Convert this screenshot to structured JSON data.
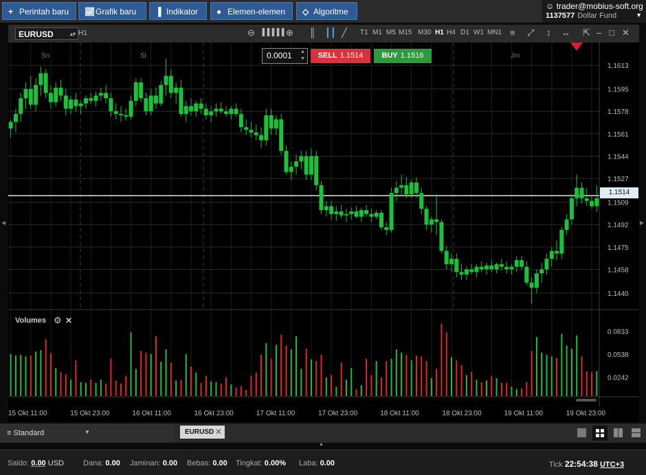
{
  "toolbar": {
    "new_order": "Perintah baru",
    "new_chart": "Grafik baru",
    "indicators": "Indikator",
    "elements": "Elemen-elemen",
    "algorithms": "Algoritme"
  },
  "account": {
    "user": "trader@mobius-soft.org",
    "number": "1137577",
    "fund": "Dollar Fund"
  },
  "chart_header": {
    "symbol": "EURUSD",
    "period": "H1",
    "timeframes": [
      "T1",
      "M1",
      "M5",
      "M15",
      "M30",
      "H1",
      "H4",
      "D1",
      "W1",
      "MN1"
    ],
    "active_timeframe": "H1"
  },
  "trade": {
    "step": "0.0001",
    "sell_label": "SELL",
    "sell_price": "1.1514",
    "buy_label": "BUY",
    "buy_price": "1.1516",
    "sell_color": "#d9323a",
    "buy_color": "#2e9a3c"
  },
  "current_price": "1.1514",
  "volumes_panel": {
    "title": "Volumes"
  },
  "chart_data": {
    "type": "candlestick",
    "symbol": "EURUSD",
    "period": "H1",
    "day_labels": [
      "Sn",
      "Sl",
      "Jm"
    ],
    "price_axis_ticks": [
      "1.1613",
      "1.1595",
      "1.1578",
      "1.1561",
      "1.1544",
      "1.1527",
      "1.1509",
      "1.1492",
      "1.1475",
      "1.1458",
      "1.1440"
    ],
    "ylim": [
      1.1428,
      1.1624
    ],
    "volume_axis_ticks": [
      "0.0833",
      "0.0538",
      "0.0242"
    ],
    "volume_ylim": [
      0,
      0.105
    ],
    "x_axis_labels": [
      "15 Okt 11:00",
      "15 Okt 23:00",
      "16 Okt 11:00",
      "16 Okt 23:00",
      "17 Okt 11:00",
      "17 Okt 23:00",
      "18 Okt 11:00",
      "18 Okt 23:00",
      "19 Okt 11:00",
      "19 Okt 23:00"
    ],
    "up_color": "#19c23a",
    "down_color": "#e8242b",
    "candles": [
      [
        1.1565,
        1.1572,
        1.1558,
        1.157
      ],
      [
        1.157,
        1.158,
        1.1562,
        1.1576
      ],
      [
        1.1576,
        1.1592,
        1.157,
        1.1588
      ],
      [
        1.1588,
        1.16,
        1.158,
        1.1595
      ],
      [
        1.1595,
        1.1605,
        1.158,
        1.1583
      ],
      [
        1.1583,
        1.1603,
        1.1578,
        1.1598
      ],
      [
        1.1598,
        1.1612,
        1.159,
        1.1607
      ],
      [
        1.1607,
        1.161,
        1.1588,
        1.1592
      ],
      [
        1.1592,
        1.1598,
        1.158,
        1.1585
      ],
      [
        1.1585,
        1.16,
        1.1582,
        1.1596
      ],
      [
        1.1596,
        1.1602,
        1.1586,
        1.159
      ],
      [
        1.159,
        1.1595,
        1.1575,
        1.158
      ],
      [
        1.158,
        1.159,
        1.1576,
        1.1587
      ],
      [
        1.1587,
        1.1592,
        1.1578,
        1.1582
      ],
      [
        1.1582,
        1.1586,
        1.1576,
        1.1584
      ],
      [
        1.1584,
        1.159,
        1.158,
        1.1588
      ],
      [
        1.1588,
        1.1592,
        1.1584,
        1.1586
      ],
      [
        1.1586,
        1.1593,
        1.1582,
        1.159
      ],
      [
        1.159,
        1.1596,
        1.1586,
        1.1592
      ],
      [
        1.1592,
        1.1598,
        1.1584,
        1.1588
      ],
      [
        1.1588,
        1.1592,
        1.1574,
        1.1578
      ],
      [
        1.1578,
        1.1584,
        1.1572,
        1.1576
      ],
      [
        1.1576,
        1.1582,
        1.157,
        1.1575
      ],
      [
        1.1575,
        1.158,
        1.1571,
        1.1574
      ],
      [
        1.1574,
        1.159,
        1.1572,
        1.1586
      ],
      [
        1.1586,
        1.1603,
        1.1582,
        1.16
      ],
      [
        1.16,
        1.1603,
        1.1585,
        1.1588
      ],
      [
        1.1588,
        1.1592,
        1.1575,
        1.1578
      ],
      [
        1.1578,
        1.1595,
        1.1575,
        1.159
      ],
      [
        1.159,
        1.1596,
        1.158,
        1.1584
      ],
      [
        1.1584,
        1.1601,
        1.1582,
        1.1598
      ],
      [
        1.1598,
        1.1618,
        1.159,
        1.1605
      ],
      [
        1.1605,
        1.161,
        1.1588,
        1.1592
      ],
      [
        1.1592,
        1.16,
        1.1584,
        1.1596
      ],
      [
        1.1596,
        1.1602,
        1.1574,
        1.1576
      ],
      [
        1.1576,
        1.1586,
        1.157,
        1.1582
      ],
      [
        1.1582,
        1.1588,
        1.1575,
        1.1578
      ],
      [
        1.1578,
        1.1586,
        1.1574,
        1.1584
      ],
      [
        1.1584,
        1.1588,
        1.1576,
        1.158
      ],
      [
        1.158,
        1.1584,
        1.1572,
        1.1575
      ],
      [
        1.1575,
        1.1582,
        1.157,
        1.1578
      ],
      [
        1.1578,
        1.1584,
        1.1574,
        1.158
      ],
      [
        1.158,
        1.1585,
        1.1576,
        1.1578
      ],
      [
        1.1578,
        1.1582,
        1.1574,
        1.1576
      ],
      [
        1.1576,
        1.1582,
        1.1572,
        1.158
      ],
      [
        1.158,
        1.1584,
        1.1574,
        1.1576
      ],
      [
        1.1576,
        1.158,
        1.1562,
        1.1566
      ],
      [
        1.1566,
        1.1572,
        1.156,
        1.1564
      ],
      [
        1.1564,
        1.157,
        1.1558,
        1.1562
      ],
      [
        1.1562,
        1.1568,
        1.1556,
        1.156
      ],
      [
        1.156,
        1.1566,
        1.155,
        1.1556
      ],
      [
        1.1556,
        1.158,
        1.1552,
        1.1575
      ],
      [
        1.1575,
        1.158,
        1.156,
        1.1565
      ],
      [
        1.1565,
        1.1575,
        1.156,
        1.1572
      ],
      [
        1.1572,
        1.1576,
        1.1545,
        1.1548
      ],
      [
        1.1548,
        1.1552,
        1.153,
        1.1532
      ],
      [
        1.1532,
        1.154,
        1.1526,
        1.1536
      ],
      [
        1.1536,
        1.1545,
        1.153,
        1.154
      ],
      [
        1.154,
        1.1548,
        1.1534,
        1.1544
      ],
      [
        1.1544,
        1.1548,
        1.1526,
        1.153
      ],
      [
        1.153,
        1.155,
        1.1526,
        1.1544
      ],
      [
        1.1544,
        1.1548,
        1.1518,
        1.1522
      ],
      [
        1.1522,
        1.1525,
        1.15,
        1.1503
      ],
      [
        1.1503,
        1.151,
        1.1498,
        1.1506
      ],
      [
        1.1506,
        1.151,
        1.1496,
        1.15
      ],
      [
        1.15,
        1.1506,
        1.1495,
        1.1502
      ],
      [
        1.1502,
        1.1507,
        1.1497,
        1.1499
      ],
      [
        1.1499,
        1.1504,
        1.1494,
        1.15
      ],
      [
        1.15,
        1.1505,
        1.1496,
        1.1502
      ],
      [
        1.1502,
        1.1506,
        1.1497,
        1.1498
      ],
      [
        1.1498,
        1.1505,
        1.1494,
        1.1503
      ],
      [
        1.1503,
        1.1507,
        1.1498,
        1.15
      ],
      [
        1.15,
        1.1504,
        1.1494,
        1.1498
      ],
      [
        1.1498,
        1.1503,
        1.1496,
        1.1501
      ],
      [
        1.1501,
        1.1503,
        1.1488,
        1.149
      ],
      [
        1.149,
        1.1494,
        1.1484,
        1.1488
      ],
      [
        1.1488,
        1.152,
        1.1486,
        1.1516
      ],
      [
        1.1516,
        1.1525,
        1.151,
        1.152
      ],
      [
        1.152,
        1.153,
        1.1514,
        1.1522
      ],
      [
        1.1522,
        1.1528,
        1.1512,
        1.1515
      ],
      [
        1.1515,
        1.1526,
        1.1512,
        1.1524
      ],
      [
        1.1524,
        1.1528,
        1.1512,
        1.1516
      ],
      [
        1.1516,
        1.152,
        1.15,
        1.1504
      ],
      [
        1.1504,
        1.1506,
        1.1488,
        1.1492
      ],
      [
        1.1492,
        1.1498,
        1.1486,
        1.1496
      ],
      [
        1.1496,
        1.1515,
        1.1484,
        1.1494
      ],
      [
        1.1494,
        1.1496,
        1.147,
        1.1472
      ],
      [
        1.1472,
        1.1476,
        1.1458,
        1.1462
      ],
      [
        1.1462,
        1.147,
        1.1456,
        1.1466
      ],
      [
        1.1466,
        1.147,
        1.1452,
        1.1456
      ],
      [
        1.1456,
        1.1462,
        1.145,
        1.1454
      ],
      [
        1.1454,
        1.146,
        1.145,
        1.1458
      ],
      [
        1.1458,
        1.1462,
        1.1454,
        1.1456
      ],
      [
        1.1456,
        1.1462,
        1.1452,
        1.146
      ],
      [
        1.146,
        1.1464,
        1.1456,
        1.1458
      ],
      [
        1.1458,
        1.1463,
        1.1454,
        1.1461
      ],
      [
        1.1461,
        1.1465,
        1.1456,
        1.1458
      ],
      [
        1.1458,
        1.1463,
        1.1455,
        1.1462
      ],
      [
        1.1462,
        1.1466,
        1.1457,
        1.146
      ],
      [
        1.146,
        1.1464,
        1.1455,
        1.1458
      ],
      [
        1.1458,
        1.1462,
        1.1454,
        1.146
      ],
      [
        1.146,
        1.1468,
        1.1456,
        1.1465
      ],
      [
        1.1465,
        1.1468,
        1.1458,
        1.146
      ],
      [
        1.146,
        1.1464,
        1.1446,
        1.1448
      ],
      [
        1.1448,
        1.1452,
        1.1432,
        1.1444
      ],
      [
        1.1444,
        1.1458,
        1.144,
        1.1455
      ],
      [
        1.1455,
        1.1463,
        1.1448,
        1.1458
      ],
      [
        1.1458,
        1.147,
        1.1454,
        1.1466
      ],
      [
        1.1466,
        1.1475,
        1.146,
        1.1472
      ],
      [
        1.1472,
        1.148,
        1.1465,
        1.147
      ],
      [
        1.147,
        1.149,
        1.1466,
        1.1488
      ],
      [
        1.1488,
        1.15,
        1.1484,
        1.1496
      ],
      [
        1.1496,
        1.1515,
        1.1492,
        1.1512
      ],
      [
        1.1512,
        1.153,
        1.1506,
        1.152
      ],
      [
        1.152,
        1.1524,
        1.1508,
        1.1512
      ],
      [
        1.1512,
        1.152,
        1.1506,
        1.151
      ],
      [
        1.151,
        1.1514,
        1.1504,
        1.1506
      ],
      [
        1.1506,
        1.1522,
        1.1502,
        1.1512
      ]
    ],
    "volumes": [
      0.054,
      0.052,
      0.053,
      0.051,
      0.052,
      0.057,
      0.059,
      0.073,
      0.055,
      0.036,
      0.031,
      0.028,
      0.021,
      0.046,
      0.018,
      0.017,
      0.021,
      0.017,
      0.021,
      0.016,
      0.048,
      0.02,
      0.016,
      0.026,
      0.082,
      0.035,
      0.058,
      0.056,
      0.054,
      0.077,
      0.044,
      0.06,
      0.043,
      0.02,
      0.021,
      0.054,
      0.038,
      0.03,
      0.017,
      0.026,
      0.019,
      0.018,
      0.016,
      0.024,
      0.015,
      0.011,
      0.013,
      0.008,
      0.026,
      0.03,
      0.053,
      0.068,
      0.048,
      0.066,
      0.079,
      0.065,
      0.06,
      0.077,
      0.035,
      0.061,
      0.047,
      0.045,
      0.053,
      0.024,
      0.027,
      0.012,
      0.043,
      0.021,
      0.036,
      0.009,
      0.014,
      0.048,
      0.027,
      0.045,
      0.024,
      0.045,
      0.048,
      0.06,
      0.056,
      0.053,
      0.046,
      0.052,
      0.051,
      0.045,
      0.023,
      0.035,
      0.093,
      0.082,
      0.05,
      0.046,
      0.04,
      0.027,
      0.031,
      0.021,
      0.018,
      0.02,
      0.026,
      0.023,
      0.017,
      0.017,
      0.012,
      0.009,
      0.01,
      0.018,
      0.058,
      0.076,
      0.056,
      0.053,
      0.051,
      0.049,
      0.08,
      0.065,
      0.061,
      0.078,
      0.051,
      0.032,
      0.031,
      0.032
    ]
  },
  "tabs": {
    "layout": "Standard",
    "chart_tab": "EURUSD"
  },
  "status": {
    "saldo_label": "Saldo:",
    "saldo_value": "0.00",
    "saldo_currency": "USD",
    "dana_label": "Dana:",
    "dana_value": "0.00",
    "jaminan_label": "Jaminan:",
    "jaminan_value": "0.00",
    "bebas_label": "Bebas:",
    "bebas_value": "0.00",
    "tingkat_label": "Tingkat:",
    "tingkat_value": "0.00%",
    "laba_label": "Laba:",
    "laba_value": "0.00",
    "tick_label": "Tick",
    "time": "22:54:38",
    "timezone": "UTC+3"
  }
}
